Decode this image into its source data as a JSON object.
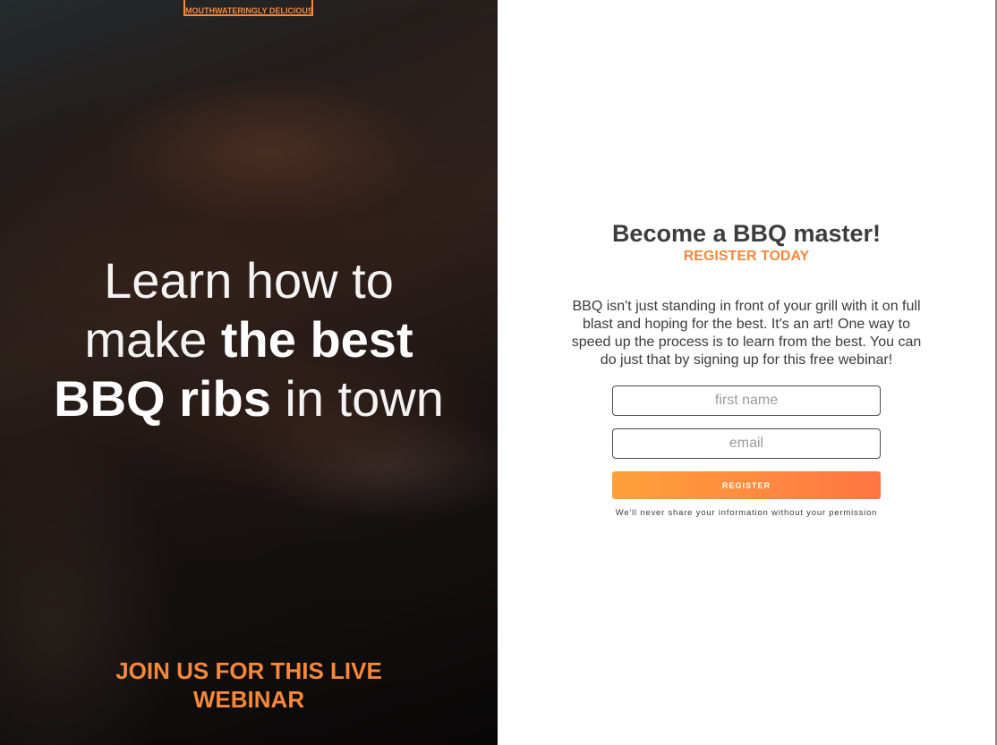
{
  "hero": {
    "badge": "MOUTHWATERINGLY DELICIOUS",
    "heading": {
      "line1": "Learn how to",
      "line2_thin": "make ",
      "line2_bold": "the best",
      "line3_bold": "BBQ ribs",
      "line3_thin": " in town"
    },
    "cta": "JOIN US FOR THIS LIVE WEBINAR"
  },
  "panel": {
    "title": "Become a BBQ master!",
    "subtitle": "REGISTER TODAY",
    "body": "BBQ isn't just standing in front of your grill with it on full blast and hoping for the best. It's an art! One way to speed up the process is to learn from the best. You can do just that by signing up for this free webinar!",
    "form": {
      "first_name_placeholder": "first name",
      "email_placeholder": "email",
      "register_label": "REGISTER"
    },
    "privacy_note": "We'll never share your information without your permission"
  },
  "colors": {
    "accent": "#f5883a",
    "button_start": "#ffa03a",
    "button_end": "#ff7442"
  }
}
